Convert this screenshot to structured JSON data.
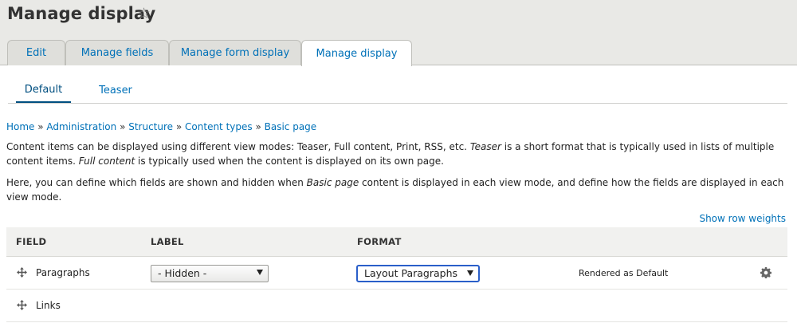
{
  "page": {
    "title": "Manage display",
    "star_icon": "☆"
  },
  "primary_tabs": [
    {
      "label": "Edit",
      "active": false
    },
    {
      "label": "Manage fields",
      "active": false
    },
    {
      "label": "Manage form display",
      "active": false
    },
    {
      "label": "Manage display",
      "active": true
    }
  ],
  "secondary_tabs": [
    {
      "label": "Default",
      "active": true
    },
    {
      "label": "Teaser",
      "active": false
    }
  ],
  "breadcrumb": {
    "items": [
      "Home",
      "Administration",
      "Structure",
      "Content types",
      "Basic page"
    ],
    "separator": "»"
  },
  "description": {
    "p1_part1": "Content items can be displayed using different view modes: Teaser, Full content, Print, RSS, etc. ",
    "p1_em1": "Teaser",
    "p1_part2": " is a short format that is typically used in lists of multiple content items. ",
    "p1_em2": "Full content",
    "p1_part3": " is typically used when the content is displayed on its own page.",
    "p2_part1": "Here, you can define which fields are shown and hidden when ",
    "p2_em1": "Basic page",
    "p2_part2": " content is displayed in each view mode, and define how the fields are displayed in each view mode."
  },
  "show_row_weights": "Show row weights",
  "table": {
    "headers": {
      "field": "FIELD",
      "label": "LABEL",
      "format": "FORMAT"
    },
    "rows": [
      {
        "field": "Paragraphs",
        "label_value": "- Hidden -",
        "format_value": "Layout Paragraphs",
        "summary": "Rendered as Default"
      },
      {
        "field": "Links"
      }
    ]
  },
  "colors": {
    "link": "#0071b8",
    "header_bg": "#e9e9e6",
    "focus": "#2a5fc9"
  }
}
